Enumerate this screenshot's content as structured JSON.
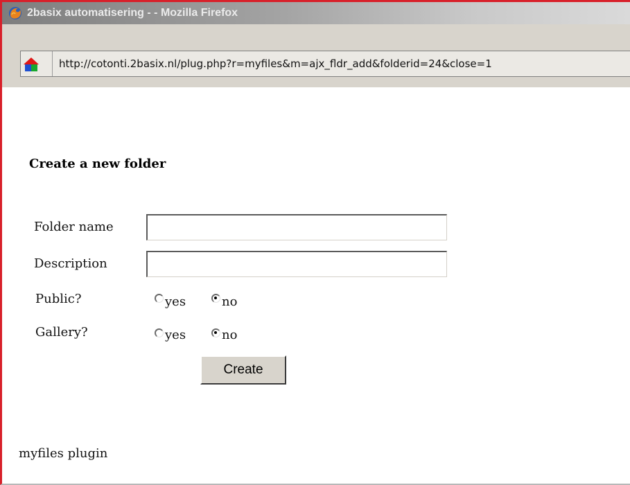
{
  "window": {
    "title": "2basix automatisering - - Mozilla Firefox"
  },
  "address_bar": {
    "url": "http://cotonti.2basix.nl/plug.php?r=myfiles&m=ajx_fldr_add&folderid=24&close=1"
  },
  "form": {
    "heading": "Create a new folder",
    "folder_name": {
      "label": "Folder name",
      "value": ""
    },
    "description": {
      "label": "Description",
      "value": ""
    },
    "public": {
      "label": "Public?",
      "options": [
        "yes",
        "no"
      ],
      "selected": "no"
    },
    "gallery": {
      "label": "Gallery?",
      "options": [
        "yes",
        "no"
      ],
      "selected": "no"
    },
    "submit_label": "Create"
  },
  "footer": {
    "text": "myfiles plugin"
  },
  "colors": {
    "window_border": "#d8202a",
    "chrome": "#d8d4cc",
    "titlebar_text": "#ebebeb"
  },
  "icons": {
    "titlebar": "firefox-icon",
    "address": "site-icon"
  }
}
